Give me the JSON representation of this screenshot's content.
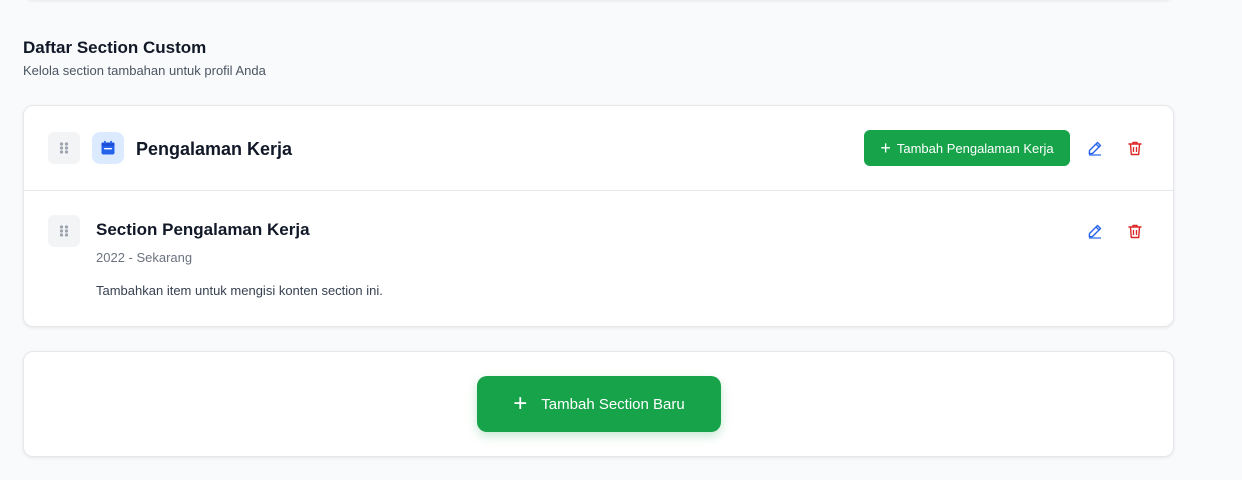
{
  "section": {
    "title": "Daftar Section Custom",
    "subtitle": "Kelola section tambahan untuk profil Anda"
  },
  "custom_section": {
    "title": "Pengalaman Kerja",
    "icon": "calendar-icon",
    "add_item_label": "Tambah Pengalaman Kerja"
  },
  "items": [
    {
      "title": "Section Pengalaman Kerja",
      "date": "2022 - Sekarang",
      "description": "Tambahkan item untuk mengisi konten section ini."
    }
  ],
  "add_section": {
    "label": "Tambah Section Baru",
    "icon": "plus-icon"
  },
  "colors": {
    "primary_green": "#16a34a",
    "edit_blue": "#2563eb",
    "delete_red": "#dc2626",
    "icon_bg": "#dbeafe"
  }
}
